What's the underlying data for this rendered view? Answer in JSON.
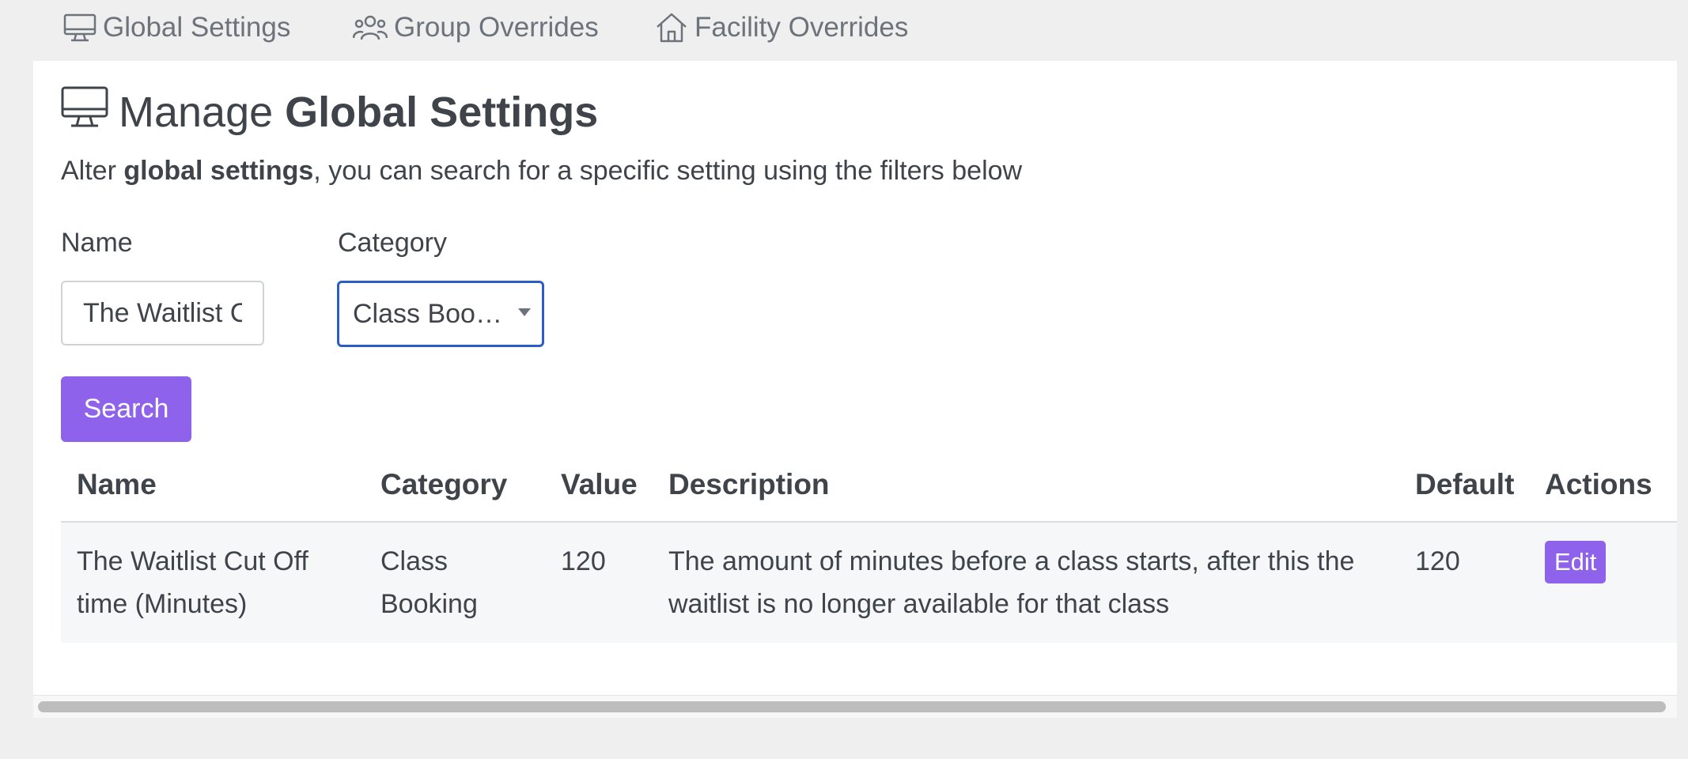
{
  "tabs": [
    {
      "label": "Global Settings",
      "icon": "monitor-icon"
    },
    {
      "label": "Group Overrides",
      "icon": "users-icon"
    },
    {
      "label": "Facility Overrides",
      "icon": "home-icon"
    }
  ],
  "header": {
    "title_prefix": "Manage",
    "title_strong": "Global Settings",
    "subtitle_prefix": "Alter",
    "subtitle_strong": "global settings",
    "subtitle_suffix": ", you can search for a specific setting using the filters below"
  },
  "filters": {
    "name_label": "Name",
    "name_value": "The Waitlist Cut Off time (Minutes)",
    "category_label": "Category",
    "category_value": "Class Boo…",
    "search_label": "Search"
  },
  "table": {
    "headers": [
      "Name",
      "Category",
      "Value",
      "Description",
      "Default",
      "Actions"
    ],
    "rows": [
      {
        "name": "The Waitlist Cut Off time (Minutes)",
        "category": "Class Booking",
        "value": "120",
        "description": "The amount of minutes before a class starts, after this the waitlist is no longer available for that class",
        "default": "120",
        "action": "Edit"
      }
    ]
  },
  "colors": {
    "accent": "#8f62ec",
    "focus_border": "#2b5cc7",
    "text": "#3f444a",
    "muted": "#6c737b"
  }
}
